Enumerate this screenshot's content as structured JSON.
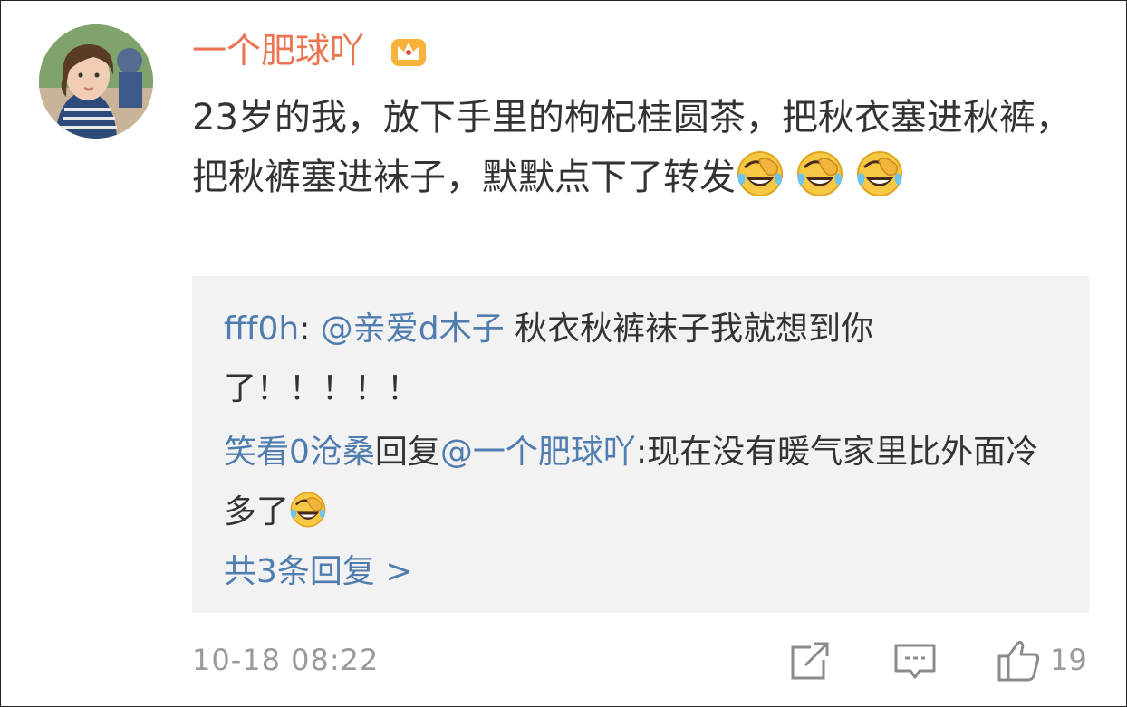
{
  "comment": {
    "username": "一个肥球吖",
    "text_part1": "23岁的我，放下手里的枸杞桂圆茶，把秋衣塞进秋裤，把秋裤塞进袜子，默默点下了转发",
    "timestamp": "10-18 08:22",
    "likes": "19",
    "emoji_name": "laughing-crying-emoji",
    "badge_icon": "crown-icon"
  },
  "replies": [
    {
      "name": "fff0h",
      "separator": ": ",
      "mention": "@亲爱d木子",
      "text": " 秋衣秋裤袜子我就想到你了！！！！！"
    },
    {
      "name": "笑看0沧桑",
      "middle": "回复",
      "mention": "@一个肥球吖",
      "text": ":现在没有暖气家里比外面冷多了"
    }
  ],
  "more_replies": "共3条回复 >",
  "colors": {
    "username": "#eb7350",
    "link": "#507daf",
    "reply_bg": "#f2f2f2",
    "meta": "#9a9a9a"
  }
}
